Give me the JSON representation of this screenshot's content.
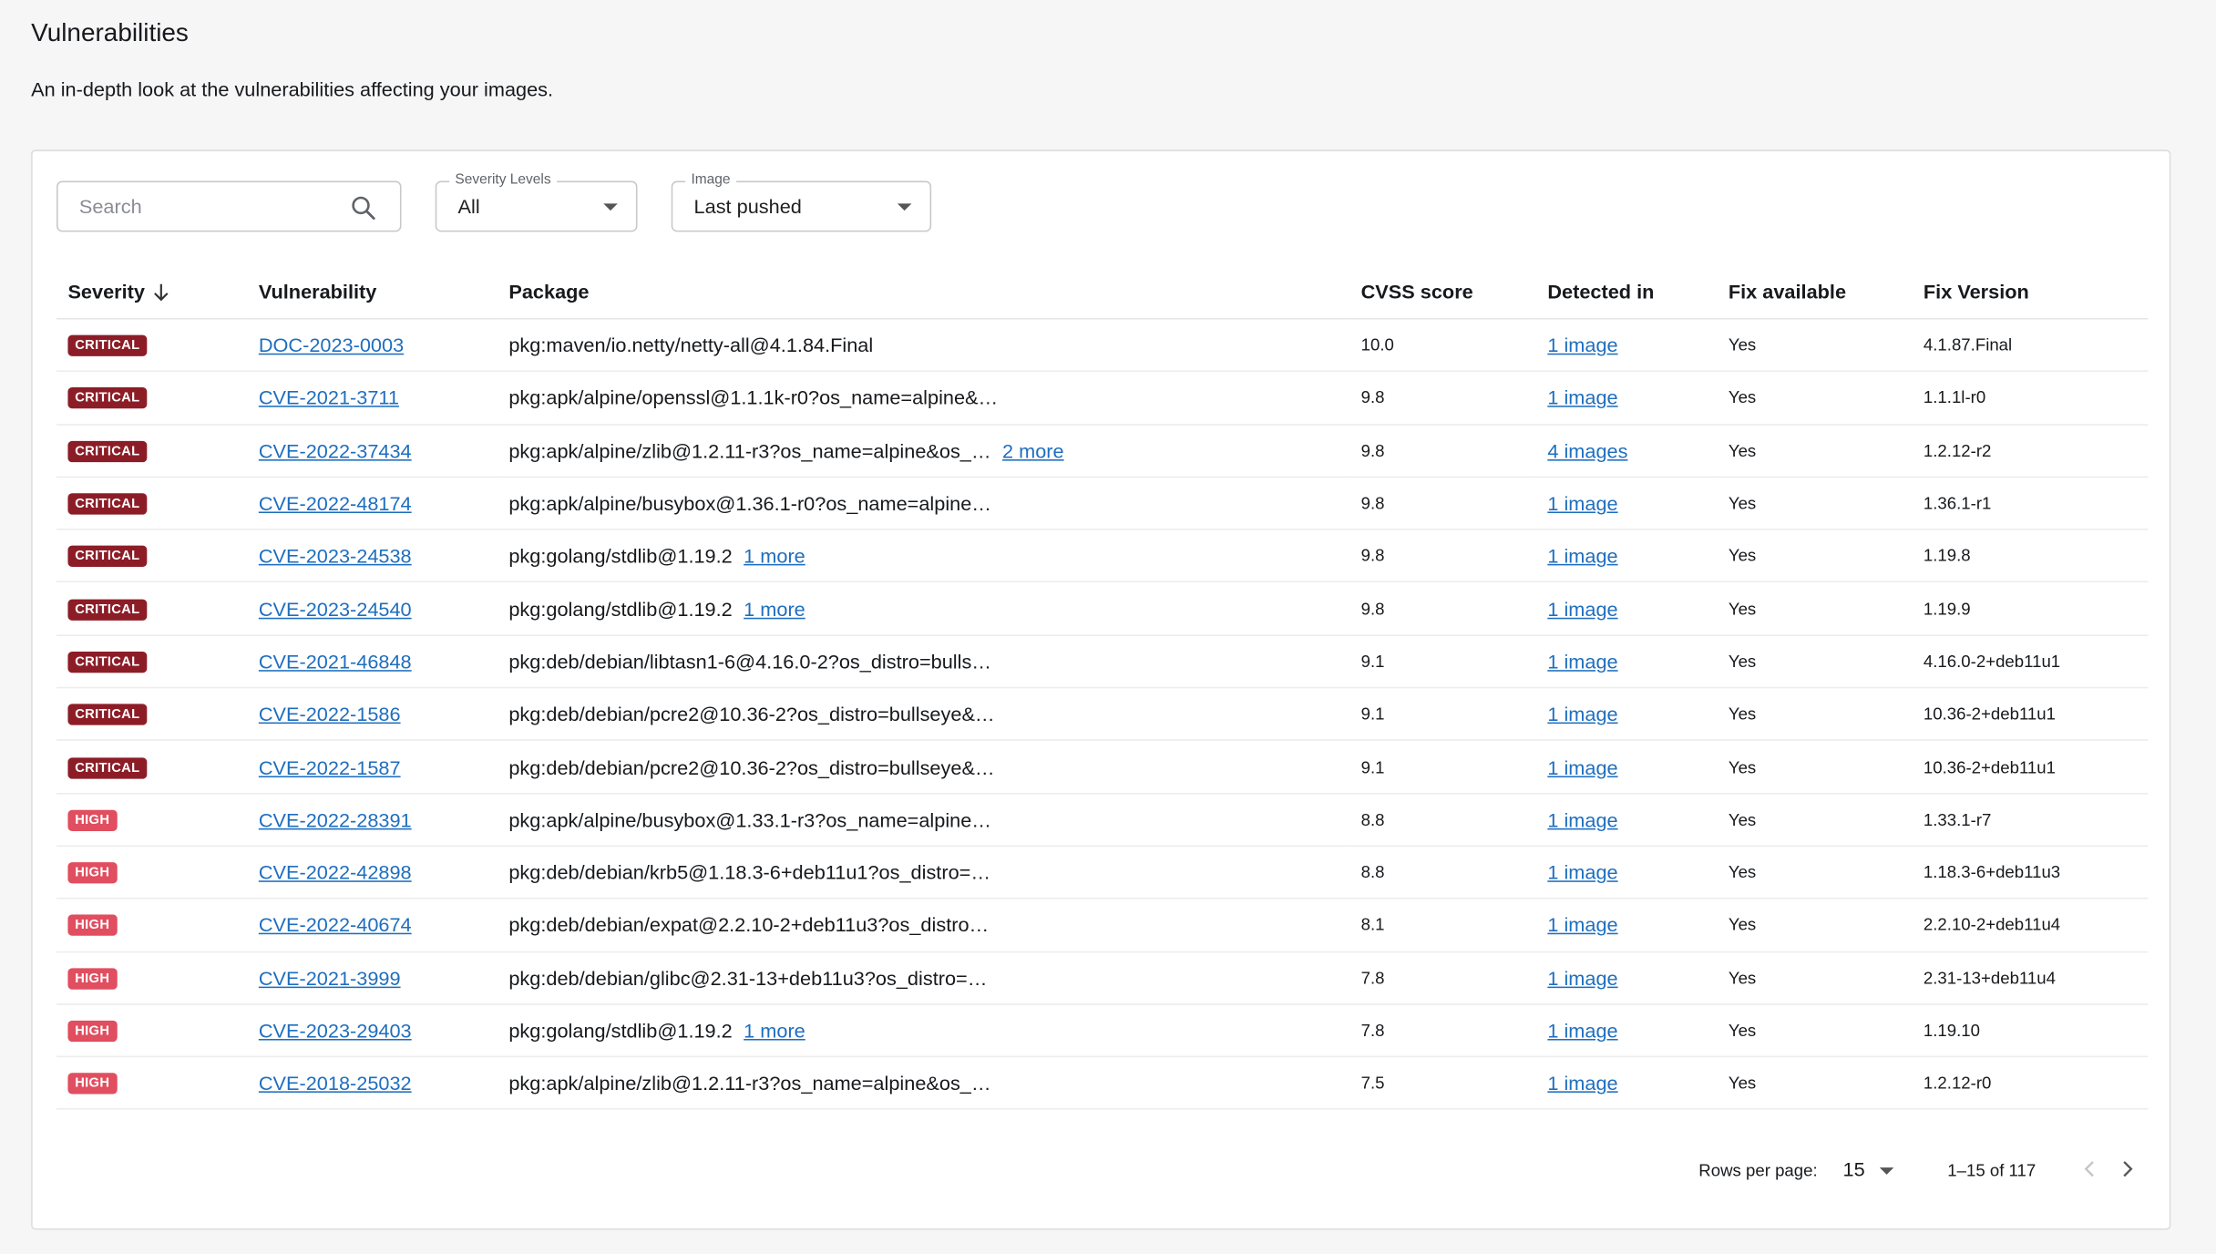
{
  "header": {
    "title": "Vulnerabilities",
    "subtitle": "An in-depth look at the vulnerabilities affecting your images."
  },
  "filters": {
    "search_placeholder": "Search",
    "severity_label": "Severity Levels",
    "severity_value": "All",
    "image_label": "Image",
    "image_value": "Last pushed"
  },
  "table": {
    "columns": [
      "Severity",
      "Vulnerability",
      "Package",
      "CVSS score",
      "Detected in",
      "Fix available",
      "Fix Version"
    ],
    "rows": [
      {
        "severity": "CRITICAL",
        "level": "critical",
        "vuln": "DOC-2023-0003",
        "package": "pkg:maven/io.netty/netty-all@4.1.84.Final",
        "more": "",
        "cvss": "10.0",
        "detected": "1 image",
        "fix": "Yes",
        "fix_version": "4.1.87.Final"
      },
      {
        "severity": "CRITICAL",
        "level": "critical",
        "vuln": "CVE-2021-3711",
        "package": "pkg:apk/alpine/openssl@1.1.1k-r0?os_name=alpine&…",
        "more": "",
        "cvss": "9.8",
        "detected": "1 image",
        "fix": "Yes",
        "fix_version": "1.1.1l-r0"
      },
      {
        "severity": "CRITICAL",
        "level": "critical",
        "vuln": "CVE-2022-37434",
        "package": "pkg:apk/alpine/zlib@1.2.11-r3?os_name=alpine&os_…",
        "more": "2 more",
        "cvss": "9.8",
        "detected": "4 images",
        "fix": "Yes",
        "fix_version": "1.2.12-r2"
      },
      {
        "severity": "CRITICAL",
        "level": "critical",
        "vuln": "CVE-2022-48174",
        "package": "pkg:apk/alpine/busybox@1.36.1-r0?os_name=alpine…",
        "more": "",
        "cvss": "9.8",
        "detected": "1 image",
        "fix": "Yes",
        "fix_version": "1.36.1-r1"
      },
      {
        "severity": "CRITICAL",
        "level": "critical",
        "vuln": "CVE-2023-24538",
        "package": "pkg:golang/stdlib@1.19.2",
        "more": "1 more",
        "cvss": "9.8",
        "detected": "1 image",
        "fix": "Yes",
        "fix_version": "1.19.8"
      },
      {
        "severity": "CRITICAL",
        "level": "critical",
        "vuln": "CVE-2023-24540",
        "package": "pkg:golang/stdlib@1.19.2",
        "more": "1 more",
        "cvss": "9.8",
        "detected": "1 image",
        "fix": "Yes",
        "fix_version": "1.19.9"
      },
      {
        "severity": "CRITICAL",
        "level": "critical",
        "vuln": "CVE-2021-46848",
        "package": "pkg:deb/debian/libtasn1-6@4.16.0-2?os_distro=bulls…",
        "more": "",
        "cvss": "9.1",
        "detected": "1 image",
        "fix": "Yes",
        "fix_version": "4.16.0-2+deb11u1"
      },
      {
        "severity": "CRITICAL",
        "level": "critical",
        "vuln": "CVE-2022-1586",
        "package": "pkg:deb/debian/pcre2@10.36-2?os_distro=bullseye&…",
        "more": "",
        "cvss": "9.1",
        "detected": "1 image",
        "fix": "Yes",
        "fix_version": "10.36-2+deb11u1"
      },
      {
        "severity": "CRITICAL",
        "level": "critical",
        "vuln": "CVE-2022-1587",
        "package": "pkg:deb/debian/pcre2@10.36-2?os_distro=bullseye&…",
        "more": "",
        "cvss": "9.1",
        "detected": "1 image",
        "fix": "Yes",
        "fix_version": "10.36-2+deb11u1"
      },
      {
        "severity": "HIGH",
        "level": "high",
        "vuln": "CVE-2022-28391",
        "package": "pkg:apk/alpine/busybox@1.33.1-r3?os_name=alpine…",
        "more": "",
        "cvss": "8.8",
        "detected": "1 image",
        "fix": "Yes",
        "fix_version": "1.33.1-r7"
      },
      {
        "severity": "HIGH",
        "level": "high",
        "vuln": "CVE-2022-42898",
        "package": "pkg:deb/debian/krb5@1.18.3-6+deb11u1?os_distro=…",
        "more": "",
        "cvss": "8.8",
        "detected": "1 image",
        "fix": "Yes",
        "fix_version": "1.18.3-6+deb11u3"
      },
      {
        "severity": "HIGH",
        "level": "high",
        "vuln": "CVE-2022-40674",
        "package": "pkg:deb/debian/expat@2.2.10-2+deb11u3?os_distro…",
        "more": "",
        "cvss": "8.1",
        "detected": "1 image",
        "fix": "Yes",
        "fix_version": "2.2.10-2+deb11u4"
      },
      {
        "severity": "HIGH",
        "level": "high",
        "vuln": "CVE-2021-3999",
        "package": "pkg:deb/debian/glibc@2.31-13+deb11u3?os_distro=…",
        "more": "",
        "cvss": "7.8",
        "detected": "1 image",
        "fix": "Yes",
        "fix_version": "2.31-13+deb11u4"
      },
      {
        "severity": "HIGH",
        "level": "high",
        "vuln": "CVE-2023-29403",
        "package": "pkg:golang/stdlib@1.19.2",
        "more": "1 more",
        "cvss": "7.8",
        "detected": "1 image",
        "fix": "Yes",
        "fix_version": "1.19.10"
      },
      {
        "severity": "HIGH",
        "level": "high",
        "vuln": "CVE-2018-25032",
        "package": "pkg:apk/alpine/zlib@1.2.11-r3?os_name=alpine&os_…",
        "more": "",
        "cvss": "7.5",
        "detected": "1 image",
        "fix": "Yes",
        "fix_version": "1.2.12-r0"
      }
    ]
  },
  "pagination": {
    "rows_label": "Rows per page:",
    "rows_value": "15",
    "range": "1–15 of 117"
  },
  "colors": {
    "critical": "#8c1d27",
    "high": "#e04e5f",
    "link": "#1e6ebf"
  },
  "icons": [
    "search-icon",
    "sort-down-arrow-icon",
    "chevron-left-icon",
    "chevron-right-icon"
  ]
}
